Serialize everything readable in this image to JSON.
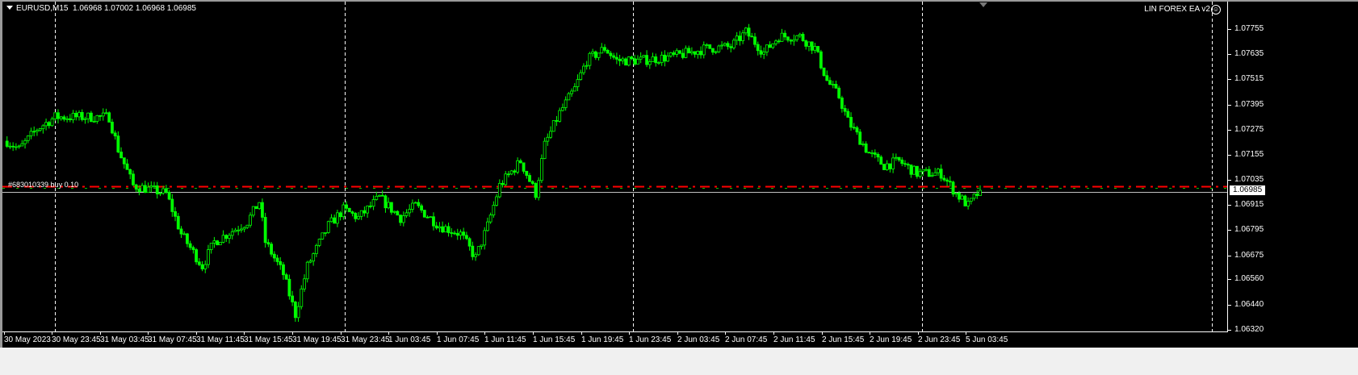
{
  "header": {
    "symbol": "EURUSD,M15",
    "ohlc": "1.06968 1.07002 1.06968 1.06985",
    "ea_label": "LIN FOREX EA  v2",
    "ea_icon": "smiley-icon"
  },
  "order_label": "#683010339 buy 0.10",
  "bid_price": "1.06985",
  "colors": {
    "bull": "#00ff00",
    "bear": "#ffffff",
    "order_line": "#ff0000",
    "sl_line": "#00c000",
    "bid_line": "#c0c0c0",
    "grid": "#ffffff",
    "background": "#000000"
  },
  "chart_data": {
    "type": "candlestick",
    "title": "EURUSD,M15",
    "y_ticks": [
      "1.07755",
      "1.07635",
      "1.07515",
      "1.07395",
      "1.07275",
      "1.07155",
      "1.07035",
      "1.06915",
      "1.06795",
      "1.06675",
      "1.06560",
      "1.06440",
      "1.06320"
    ],
    "ylim": [
      1.0632,
      1.07755
    ],
    "x_ticks": [
      "30 May 2023",
      "30 May 23:45",
      "31 May 03:45",
      "31 May 07:45",
      "31 May 11:45",
      "31 May 15:45",
      "31 May 19:45",
      "31 May 23:45",
      "1 Jun 03:45",
      "1 Jun 07:45",
      "1 Jun 11:45",
      "1 Jun 15:45",
      "1 Jun 19:45",
      "1 Jun 23:45",
      "2 Jun 03:45",
      "2 Jun 07:45",
      "2 Jun 11:45",
      "2 Jun 15:45",
      "2 Jun 19:45",
      "2 Jun 23:45",
      "5 Jun 03:45"
    ],
    "bars_per_tick": 16,
    "order_price": 1.07003,
    "bid": 1.06985,
    "close_path": [
      [
        1,
        1.0722
      ],
      [
        5,
        1.07181
      ],
      [
        11,
        1.07278
      ],
      [
        17,
        1.07335
      ],
      [
        30,
        1.07335
      ],
      [
        35,
        1.07335
      ],
      [
        38,
        1.07181
      ],
      [
        43,
        1.07008
      ],
      [
        54,
        1.0697
      ],
      [
        59,
        1.06777
      ],
      [
        66,
        1.06623
      ],
      [
        70,
        1.06739
      ],
      [
        81,
        1.06835
      ],
      [
        85,
        1.06931
      ],
      [
        87,
        1.06739
      ],
      [
        93,
        1.06585
      ],
      [
        97,
        1.06392
      ],
      [
        101,
        1.06623
      ],
      [
        108,
        1.06816
      ],
      [
        113,
        1.06893
      ],
      [
        118,
        1.06854
      ],
      [
        125,
        1.0695
      ],
      [
        132,
        1.06854
      ],
      [
        137,
        1.06912
      ],
      [
        145,
        1.06816
      ],
      [
        152,
        1.06777
      ],
      [
        157,
        1.06662
      ],
      [
        161,
        1.06816
      ],
      [
        165,
        1.07008
      ],
      [
        172,
        1.07124
      ],
      [
        177,
        1.0697
      ],
      [
        180,
        1.07201
      ],
      [
        185,
        1.07355
      ],
      [
        190,
        1.0747
      ],
      [
        194,
        1.07605
      ],
      [
        200,
        1.07663
      ],
      [
        204,
        1.07605
      ],
      [
        212,
        1.07605
      ],
      [
        223,
        1.07624
      ],
      [
        234,
        1.07663
      ],
      [
        242,
        1.0767
      ],
      [
        247,
        1.0774
      ],
      [
        253,
        1.07643
      ],
      [
        258,
        1.0772
      ],
      [
        265,
        1.0772
      ],
      [
        270,
        1.07663
      ],
      [
        274,
        1.07509
      ],
      [
        278,
        1.07432
      ],
      [
        281,
        1.07316
      ],
      [
        288,
        1.07162
      ],
      [
        293,
        1.07104
      ],
      [
        298,
        1.07124
      ],
      [
        304,
        1.07066
      ],
      [
        312,
        1.07066
      ],
      [
        317,
        1.0697
      ],
      [
        321,
        1.06912
      ],
      [
        325,
        1.06985
      ]
    ]
  }
}
